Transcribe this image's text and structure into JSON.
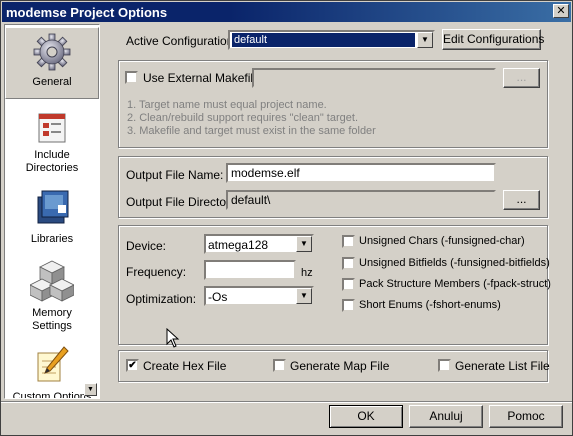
{
  "window": {
    "title": "modemse Project Options",
    "close_glyph": "✕"
  },
  "sidebar": {
    "items": [
      {
        "label": "General",
        "icon": "gear-icon"
      },
      {
        "label": "Include Directories",
        "icon": "include-directories-icon"
      },
      {
        "label": "Libraries",
        "icon": "books-icon"
      },
      {
        "label": "Memory Settings",
        "icon": "memory-blocks-icon"
      },
      {
        "label": "Custom Options",
        "icon": "pencil-note-icon"
      }
    ],
    "scroll_glyph": "▼"
  },
  "config": {
    "label": "Active Configuration",
    "value": "default",
    "edit_button": "Edit Configurations"
  },
  "makefile": {
    "checkbox_label": "Use External Makefile",
    "checked": false,
    "browse_button": "...",
    "notes": [
      "1. Target name must equal project name.",
      "2. Clean/rebuild support requires  \"clean\" target.",
      "3. Makefile and target must exist in the same folder"
    ]
  },
  "output": {
    "file_name_label": "Output File Name:",
    "file_name_value": "modemse.elf",
    "directory_label": "Output File Directory:",
    "directory_value": "default\\",
    "browse_button": "..."
  },
  "device": {
    "device_label": "Device:",
    "device_value": "atmega128",
    "frequency_label": "Frequency:",
    "frequency_value": "",
    "frequency_unit": "hz",
    "optimization_label": "Optimization:",
    "optimization_value": "-Os"
  },
  "compiler_flags": [
    {
      "label": "Unsigned Chars (-funsigned-char)",
      "checked": false
    },
    {
      "label": "Unsigned Bitfields (-funsigned-bitfields)",
      "checked": false
    },
    {
      "label": "Pack Structure Members (-fpack-struct)",
      "checked": false
    },
    {
      "label": "Short Enums (-fshort-enums)",
      "checked": false
    }
  ],
  "output_files": [
    {
      "label": "Create Hex File",
      "checked": true
    },
    {
      "label": "Generate Map File",
      "checked": false
    },
    {
      "label": "Generate List File",
      "checked": false
    }
  ],
  "check_glyph": "✔",
  "dropdown_glyph": "▼",
  "buttons": {
    "ok": "OK",
    "cancel": "Anuluj",
    "help": "Pomoc"
  }
}
